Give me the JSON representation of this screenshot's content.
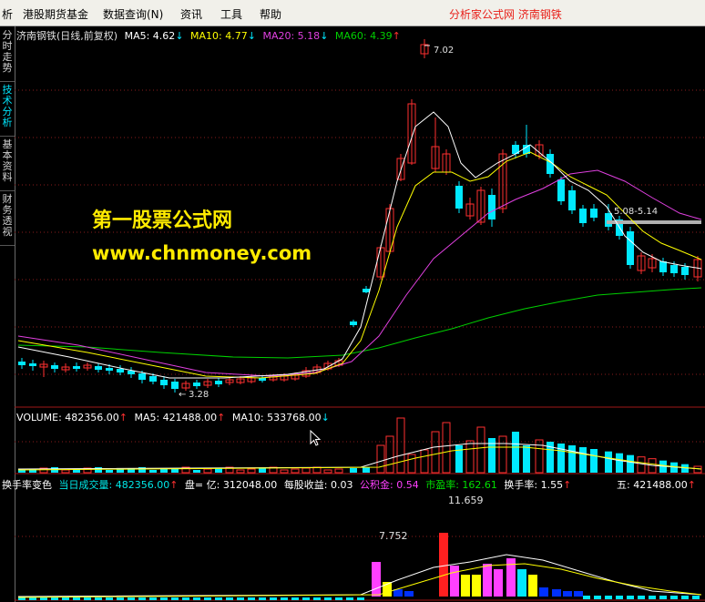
{
  "menu": {
    "items": [
      "析",
      "港股期货基金",
      "数据查询(N)",
      "资讯",
      "工具",
      "帮助"
    ],
    "right_text": "分析家公式网  济南钢铁"
  },
  "sidebar": {
    "tabs": [
      "分时走势",
      "技术分析",
      "基本资料",
      "财务透视"
    ],
    "active": "技术分析"
  },
  "main_chart": {
    "title": "济南钢铁(日线,前复权)",
    "ma": [
      {
        "label": "MA5: 4.62",
        "color": "#ffffff",
        "arrow": "↓"
      },
      {
        "label": "MA10: 4.77",
        "color": "#ffff00",
        "arrow": "↓"
      },
      {
        "label": "MA20: 5.18",
        "color": "#e040e0",
        "arrow": "↓"
      },
      {
        "label": "MA60: 4.39",
        "color": "#00d000",
        "arrow": "↑"
      }
    ],
    "high_label": "7.02",
    "low_label": "3.28",
    "range_label": "5.08-5.14",
    "watermark_line1": "第一股票公式网",
    "watermark_line2": "www.chnmoney.com"
  },
  "volume_panel": {
    "items": [
      {
        "label": "VOLUME: 482356.00",
        "color": "#ffffff",
        "arrow": "↑"
      },
      {
        "label": "MA5: 421488.00",
        "color": "#ffffff",
        "arrow": "↑"
      },
      {
        "label": "MA10: 533768.00",
        "color": "#ffffff",
        "arrow": "↓"
      }
    ]
  },
  "indicator_panel": {
    "items": [
      {
        "label": "换手率变色",
        "color": "#ffffff"
      },
      {
        "label": "当日成交量: 482356.00",
        "color": "#00e8e8",
        "arrow": "↑"
      },
      {
        "label": "盘= 亿: 312048.00",
        "color": "#ffffff"
      },
      {
        "label": "每股收益: 0.03",
        "color": "#ffffff"
      },
      {
        "label": "公积金: 0.54",
        "color": "#ff40ff"
      },
      {
        "label": "市盈率: 162.61",
        "color": "#00e000"
      },
      {
        "label": "换手率: 1.55",
        "color": "#ffffff",
        "arrow": "↑"
      },
      {
        "label": "五: 421488.00",
        "color": "#ffffff",
        "arrow": "↑"
      }
    ],
    "peak_label": "11.659",
    "second_label": "7.752"
  },
  "colors": {
    "up": "#ff3030",
    "down": "#00e8ff",
    "grid": "#8a1c1c",
    "ma5": "#ffffff",
    "ma10": "#ffff00",
    "ma20": "#e040e0",
    "ma60": "#00d000"
  },
  "icons": [
    "cursor-arrow-icon"
  ]
}
